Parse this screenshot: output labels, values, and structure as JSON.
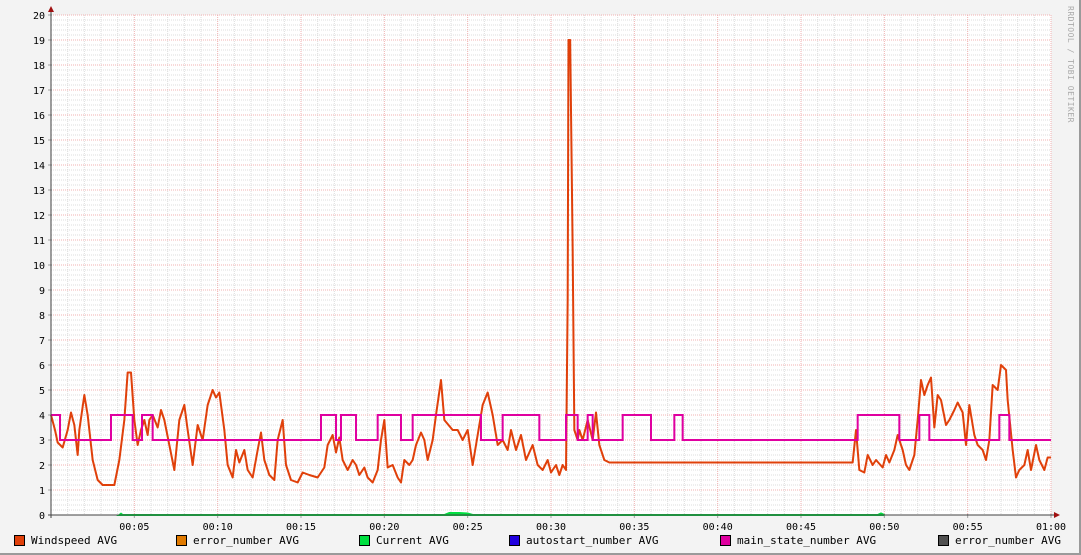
{
  "watermark": "RRDTOOL / TOBI OETIKER",
  "chart_data": {
    "type": "line",
    "title": "",
    "xlabel": "",
    "ylabel": "",
    "xlim_minutes": [
      0,
      60
    ],
    "ylim": [
      0,
      20
    ],
    "grid": true,
    "y_ticks": [
      "0",
      "1",
      "2",
      "3",
      "4",
      "5",
      "6",
      "7",
      "8",
      "9",
      "10",
      "11",
      "12",
      "13",
      "14",
      "15",
      "16",
      "17",
      "18",
      "19",
      "20"
    ],
    "x_ticks": [
      {
        "minute": 5,
        "label": "00:05"
      },
      {
        "minute": 10,
        "label": "00:10"
      },
      {
        "minute": 15,
        "label": "00:15"
      },
      {
        "minute": 20,
        "label": "00:20"
      },
      {
        "minute": 25,
        "label": "00:25"
      },
      {
        "minute": 30,
        "label": "00:30"
      },
      {
        "minute": 35,
        "label": "00:35"
      },
      {
        "minute": 40,
        "label": "00:40"
      },
      {
        "minute": 45,
        "label": "00:45"
      },
      {
        "minute": 50,
        "label": "00:50"
      },
      {
        "minute": 55,
        "label": "00:55"
      },
      {
        "minute": 60,
        "label": "01:00"
      }
    ],
    "legend_position": "bottom",
    "series": [
      {
        "name": "Windspeed AVG",
        "color": "#e0400a",
        "kind": "line",
        "x": [
          0,
          0.24,
          0.4,
          0.7,
          1.0,
          1.2,
          1.4,
          1.6,
          1.7,
          2.0,
          2.2,
          2.5,
          2.8,
          3.1,
          3.5,
          3.8,
          4.1,
          4.4,
          4.6,
          4.8,
          5.0,
          5.2,
          5.4,
          5.6,
          5.8,
          5.9,
          6.1,
          6.4,
          6.6,
          6.8,
          7.1,
          7.4,
          7.7,
          8.0,
          8.2,
          8.5,
          8.8,
          9.1,
          9.4,
          9.7,
          9.9,
          10.1,
          10.4,
          10.6,
          10.9,
          11.1,
          11.3,
          11.6,
          11.8,
          12.1,
          12.4,
          12.6,
          12.8,
          13.1,
          13.4,
          13.6,
          13.9,
          14.1,
          14.4,
          14.8,
          15.1,
          15.5,
          16.0,
          16.4,
          16.6,
          16.9,
          17.1,
          17.3,
          17.5,
          17.8,
          18.1,
          18.3,
          18.5,
          18.8,
          19.0,
          19.3,
          19.6,
          19.8,
          20.0,
          20.2,
          20.5,
          20.8,
          21.0,
          21.2,
          21.5,
          21.7,
          21.9,
          22.2,
          22.4,
          22.6,
          22.9,
          23.1,
          23.4,
          23.6,
          24.1,
          24.4,
          24.7,
          25.0,
          25.3,
          25.6,
          25.9,
          26.2,
          26.5,
          26.8,
          27.1,
          27.4,
          27.6,
          27.9,
          28.2,
          28.5,
          28.9,
          29.2,
          29.5,
          29.8,
          30.0,
          30.3,
          30.5,
          30.7,
          30.9,
          31.0,
          31.05,
          31.15,
          31.3,
          31.4,
          31.6,
          31.7,
          31.9,
          32.2,
          32.5,
          32.7,
          32.9,
          33.2,
          33.5,
          48.1,
          48.3,
          48.5,
          48.8,
          49.0,
          49.3,
          49.5,
          49.9,
          50.1,
          50.3,
          50.6,
          50.8,
          51.1,
          51.3,
          51.5,
          51.8,
          52.0,
          52.2,
          52.4,
          52.6,
          52.8,
          53.0,
          53.2,
          53.4,
          53.7,
          53.9,
          54.2,
          54.4,
          54.7,
          54.9,
          55.1,
          55.4,
          55.6,
          55.9,
          56.1,
          56.3,
          56.5,
          56.8,
          57.0,
          57.3,
          57.4,
          57.7,
          57.9,
          58.1,
          58.4,
          58.6,
          58.8,
          59.1,
          59.3,
          59.6,
          59.8,
          60
        ],
        "y": [
          4,
          3.4,
          2.9,
          2.7,
          3.4,
          4.1,
          3.6,
          2.4,
          3.4,
          4.8,
          4,
          2.2,
          1.4,
          1.2,
          1.2,
          1.2,
          2.2,
          3.8,
          5.7,
          5.7,
          3.8,
          2.8,
          3.4,
          3.8,
          3.2,
          3.8,
          4,
          3.5,
          4.2,
          3.8,
          2.8,
          1.8,
          3.8,
          4.4,
          3.4,
          2,
          3.6,
          3.0,
          4.4,
          5,
          4.7,
          4.9,
          3.4,
          2,
          1.5,
          2.6,
          2.1,
          2.6,
          1.8,
          1.5,
          2.6,
          3.3,
          2.2,
          1.6,
          1.4,
          3,
          3.8,
          2,
          1.4,
          1.3,
          1.7,
          1.6,
          1.5,
          1.9,
          2.8,
          3.2,
          2.5,
          3.1,
          2.2,
          1.8,
          2.2,
          2,
          1.6,
          1.9,
          1.5,
          1.3,
          1.8,
          3,
          3.8,
          1.9,
          2,
          1.5,
          1.3,
          2.2,
          2,
          2.2,
          2.8,
          3.3,
          3,
          2.2,
          3,
          4,
          5.4,
          3.8,
          3.4,
          3.4,
          3,
          3.4,
          2,
          3.2,
          4.4,
          4.9,
          4,
          2.8,
          3,
          2.6,
          3.4,
          2.6,
          3.2,
          2.2,
          2.8,
          2,
          1.8,
          2.2,
          1.7,
          2,
          1.6,
          2,
          1.8,
          8.6,
          19,
          19,
          10.6,
          3.4,
          3,
          3.4,
          3,
          3.8,
          3,
          4.1,
          2.8,
          2.2,
          2.1,
          2.1,
          3.4,
          1.8,
          1.7,
          2.4,
          2,
          2.2,
          1.9,
          2.4,
          2.1,
          2.6,
          3.2,
          2.6,
          2,
          1.8,
          2.4,
          3.8,
          5.4,
          4.8,
          5.2,
          5.5,
          3.5,
          4.8,
          4.6,
          3.6,
          3.8,
          4.2,
          4.5,
          4.1,
          2.8,
          4.4,
          3.2,
          2.8,
          2.6,
          2.2,
          3,
          5.2,
          5,
          6,
          5.8,
          4.6,
          2.6,
          1.5,
          1.8,
          2,
          2.6,
          1.8,
          2.8,
          2.2,
          1.8,
          2.3,
          2.3
        ]
      },
      {
        "name": "error_number AVG",
        "color": "#e07a00",
        "kind": "line",
        "x": [],
        "y": []
      },
      {
        "name": "Current AVG",
        "color": "#00e040",
        "kind": "area",
        "x": [
          4.1,
          4.2,
          4.3,
          23.6,
          23.9,
          24.5,
          25.0,
          25.3,
          49.6,
          49.8,
          50.0
        ],
        "y": [
          0,
          0.05,
          0,
          0,
          0.08,
          0.08,
          0.06,
          0,
          0,
          0.06,
          0
        ]
      },
      {
        "name": "autostart_number AVG",
        "color": "#2000e0",
        "kind": "line",
        "x": [],
        "y": []
      },
      {
        "name": "main_state_number AVG",
        "color": "#e000a0",
        "kind": "step",
        "x": [
          0,
          0.54,
          3.6,
          4.9,
          5.46,
          6.1,
          16.2,
          17.1,
          17.4,
          18.3,
          19.6,
          21.0,
          21.7,
          25.8,
          27.1,
          29.3,
          30.9,
          31.6,
          32.2,
          32.5,
          34.3,
          36.0,
          37.4,
          37.9,
          48.4,
          50.9,
          52.1,
          52.7,
          56.9,
          57.5,
          60
        ],
        "y": [
          4,
          3,
          4,
          3,
          4,
          3,
          4,
          3,
          4,
          3,
          4,
          3,
          4,
          3,
          4,
          3,
          4,
          3,
          4,
          3,
          4,
          3,
          4,
          3,
          4,
          3,
          4,
          3,
          4,
          3,
          3
        ]
      },
      {
        "name": "error_number AVG",
        "color": "#505050",
        "kind": "line",
        "x": [],
        "y": []
      }
    ]
  }
}
